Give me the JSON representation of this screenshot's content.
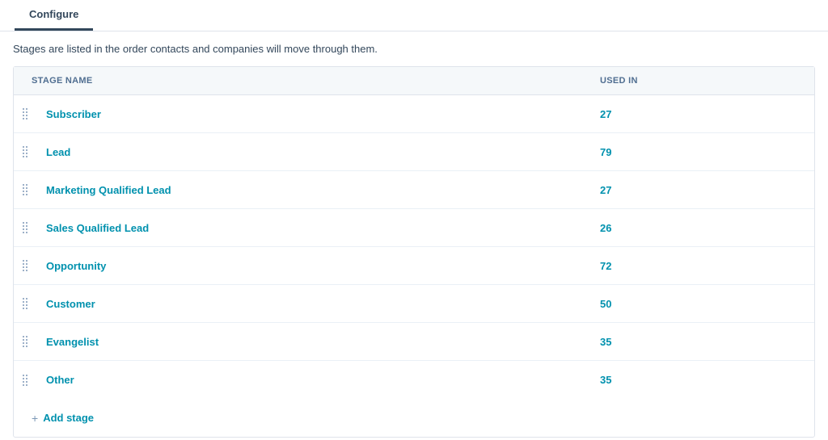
{
  "tab_label": "Configure",
  "description": "Stages are listed in the order contacts and companies will move through them.",
  "columns": {
    "name": "STAGE NAME",
    "used": "USED IN"
  },
  "stages": [
    {
      "name": "Subscriber",
      "used_in": "27"
    },
    {
      "name": "Lead",
      "used_in": "79"
    },
    {
      "name": "Marketing Qualified Lead",
      "used_in": "27"
    },
    {
      "name": "Sales Qualified Lead",
      "used_in": "26"
    },
    {
      "name": "Opportunity",
      "used_in": "72"
    },
    {
      "name": "Customer",
      "used_in": "50"
    },
    {
      "name": "Evangelist",
      "used_in": "35"
    },
    {
      "name": "Other",
      "used_in": "35"
    }
  ],
  "add_stage_label": "Add stage"
}
